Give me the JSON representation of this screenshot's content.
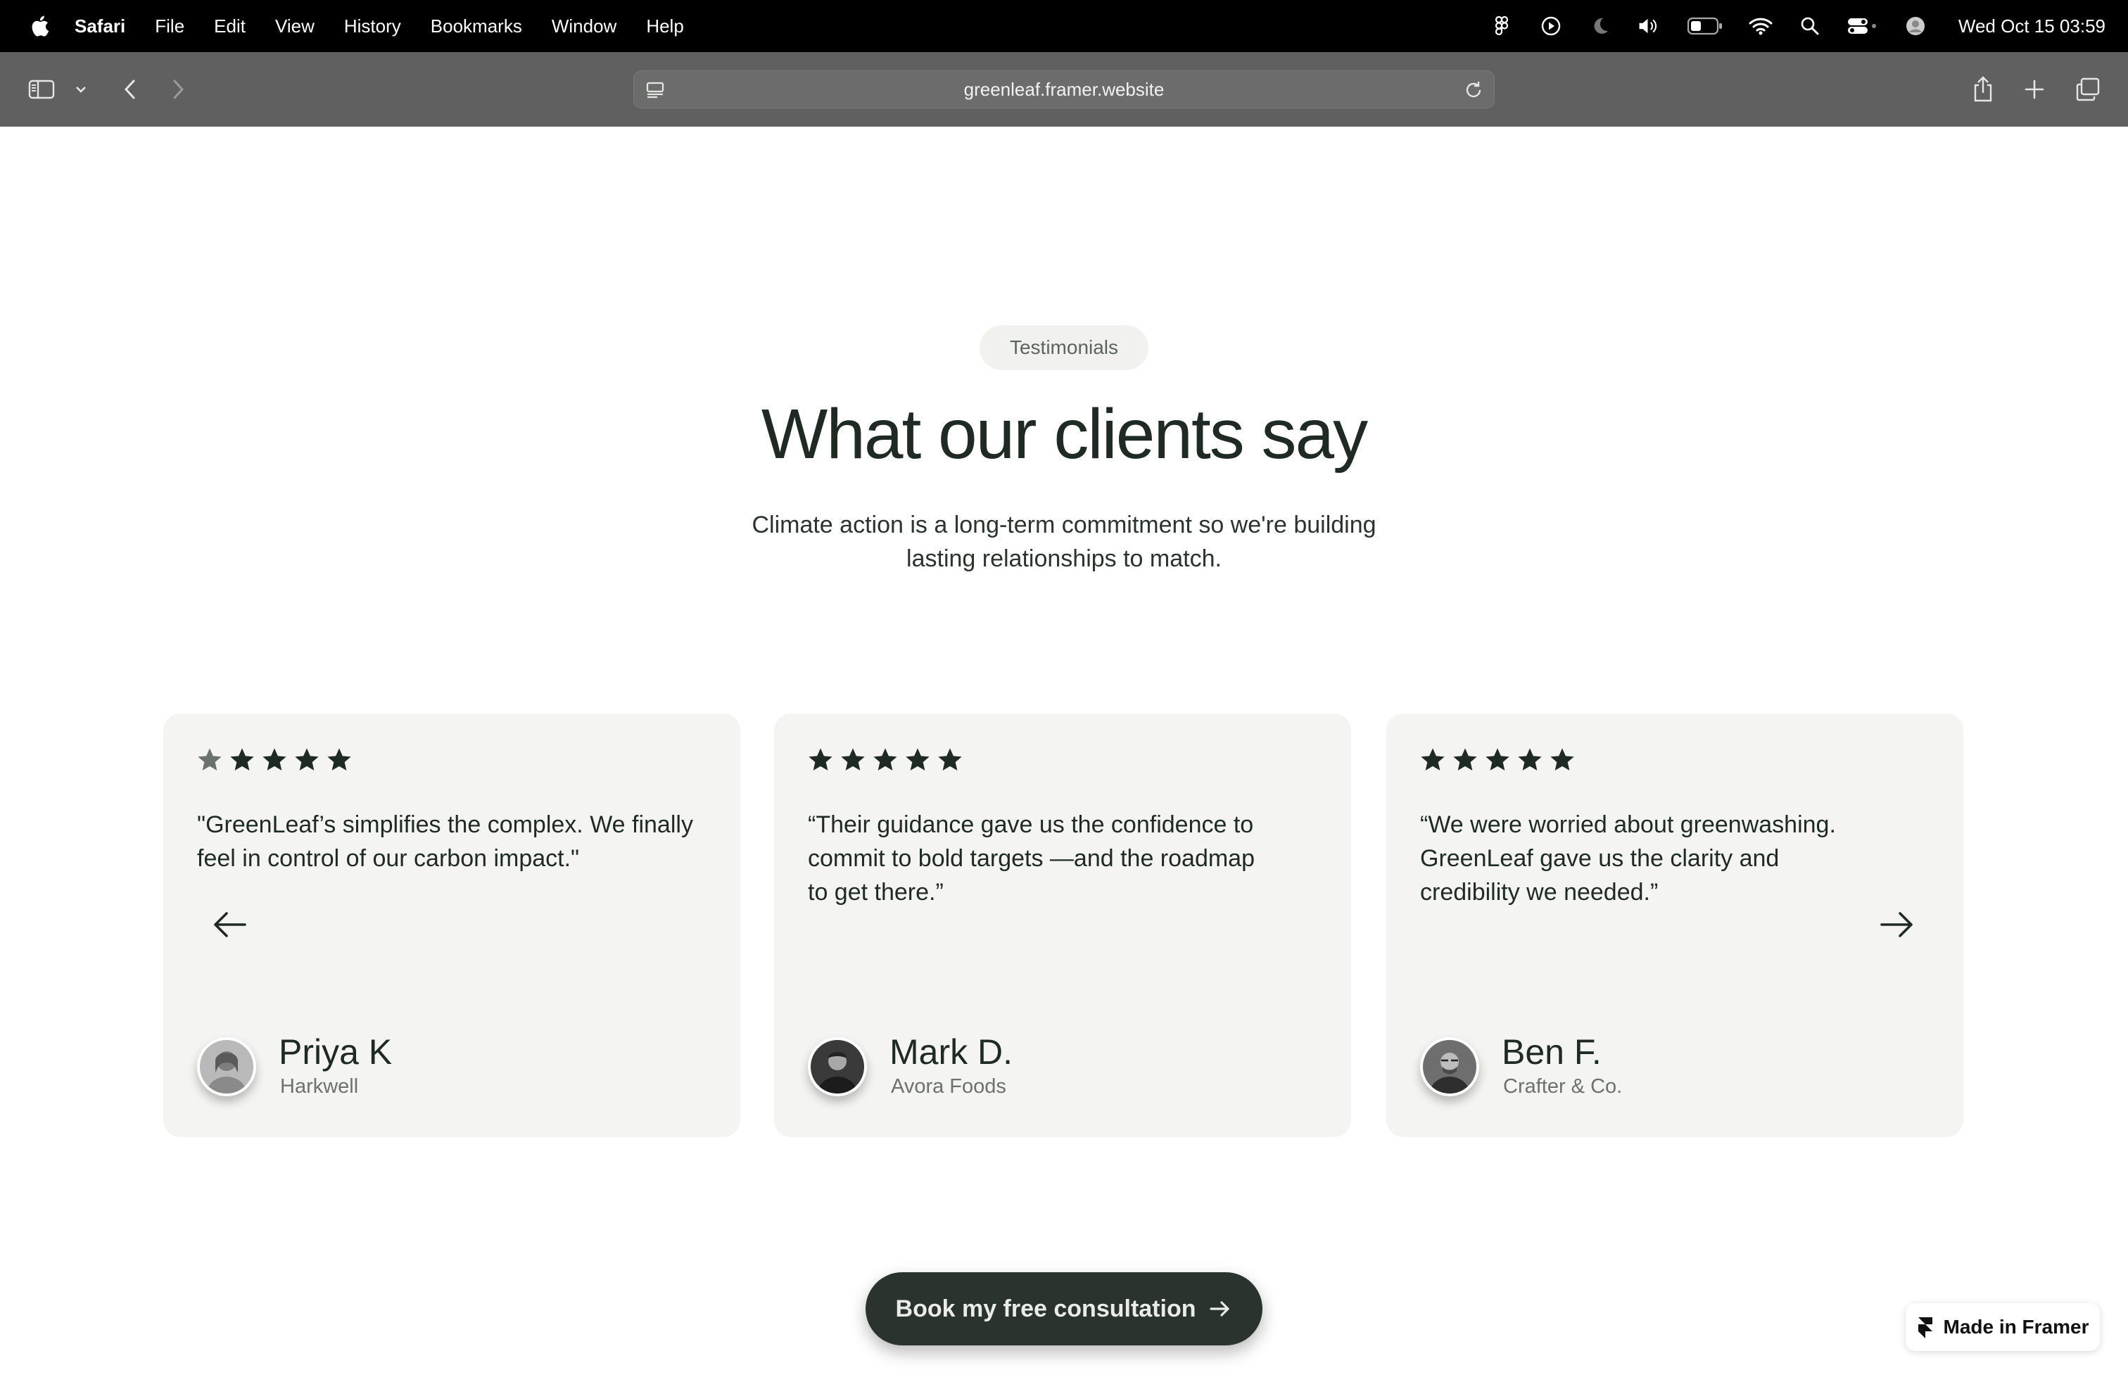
{
  "menubar": {
    "app_name": "Safari",
    "items": [
      "File",
      "Edit",
      "View",
      "History",
      "Bookmarks",
      "Window",
      "Help"
    ],
    "clock": "Wed Oct 15  03:59"
  },
  "browser": {
    "url": "greenleaf.framer.website"
  },
  "section": {
    "pill": "Testimonials",
    "headline": "What our clients say",
    "subtitle": "Climate action is a long-term commitment so we're building lasting relationships to match."
  },
  "testimonials": [
    {
      "rating": 5,
      "quote": "\"GreenLeaf’s simplifies the complex. We finally feel in control of our carbon impact.\"",
      "name": "Priya K",
      "company": "Harkwell"
    },
    {
      "rating": 5,
      "quote": "“Their guidance gave us the confidence to commit to bold targets —and the roadmap to get there.”",
      "name": "Mark D.",
      "company": "Avora Foods"
    },
    {
      "rating": 5,
      "quote": "“We were worried about greenwashing. GreenLeaf gave us the clarity and credibility we needed.”",
      "name": "Ben F.",
      "company": "Crafter & Co."
    }
  ],
  "cta": {
    "label": "Book my free consultation"
  },
  "badge": {
    "label": "Made in Framer"
  },
  "colors": {
    "accent_dark": "#2a332e",
    "card_bg": "#f4f4f3",
    "toolbar_bg": "#5f605f"
  },
  "icons": {
    "carousel_prev": "arrow-left-icon",
    "carousel_next": "arrow-right-icon",
    "rating": "star-icon"
  }
}
